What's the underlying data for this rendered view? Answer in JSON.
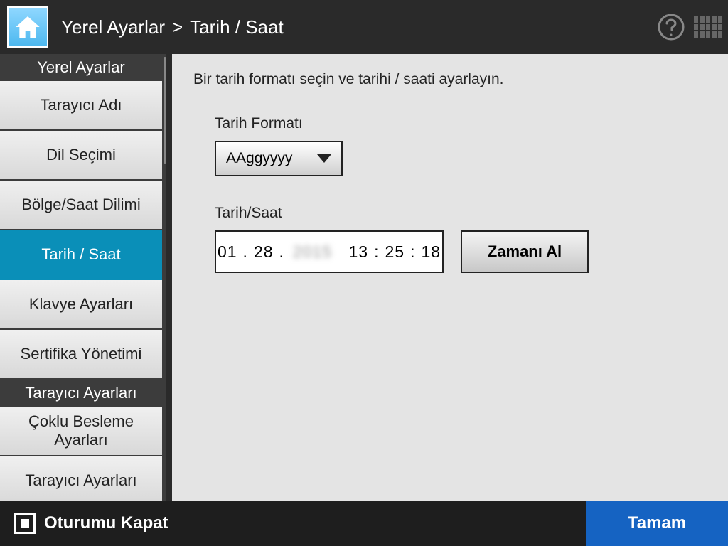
{
  "header": {
    "breadcrumb_root": "Yerel Ayarlar",
    "breadcrumb_sep": ">",
    "breadcrumb_leaf": "Tarih / Saat"
  },
  "sidebar": {
    "section1_header": "Yerel Ayarlar",
    "items": [
      {
        "label": "Tarayıcı Adı",
        "active": false
      },
      {
        "label": "Dil Seçimi",
        "active": false
      },
      {
        "label": "Bölge/Saat Dilimi",
        "active": false
      },
      {
        "label": "Tarih / Saat",
        "active": true
      },
      {
        "label": "Klavye Ayarları",
        "active": false
      },
      {
        "label": "Sertifika Yönetimi",
        "active": false
      }
    ],
    "section2_header": "Tarayıcı Ayarları",
    "items2": [
      {
        "label_line1": "Çoklu Besleme",
        "label_line2": "Ayarları",
        "active": false
      },
      {
        "label": "Tarayıcı Ayarları",
        "active": false
      }
    ]
  },
  "main": {
    "instruction": "Bir tarih formatı seçin ve tarihi / saati ayarlayın.",
    "date_format_label": "Tarih Formatı",
    "date_format_value": "AAggyyyy",
    "date_time_label": "Tarih/Saat",
    "date": {
      "month": "01",
      "day": "28",
      "year": "2015"
    },
    "time": {
      "h": "13",
      "m": "25",
      "s": "18"
    },
    "dot": ".",
    "colon": ":",
    "get_time_label": "Zamanı Al"
  },
  "footer": {
    "logout_label": "Oturumu Kapat",
    "ok_label": "Tamam"
  }
}
